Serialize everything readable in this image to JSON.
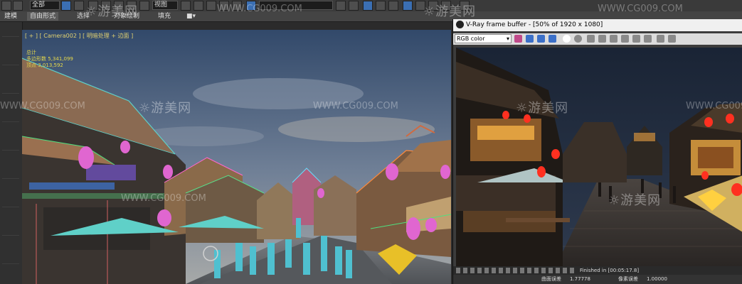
{
  "toolbar": {
    "selection_filter": "全部",
    "view_dropdown": "视图",
    "named_set_field": "",
    "icons": [
      "undo-icon",
      "redo-icon",
      "link-icon",
      "unlink-icon",
      "bind-icon",
      "select-icon",
      "select-region-icon",
      "move-icon",
      "rotate-icon",
      "scale-icon",
      "snap-icon",
      "angle-snap-icon",
      "mirror-icon",
      "align-icon",
      "layer-icon",
      "curve-editor-icon",
      "schematic-icon",
      "material-editor-icon",
      "render-setup-icon",
      "render-frame-icon",
      "render-icon",
      "chat-icon"
    ]
  },
  "ribbon": {
    "tabs": [
      {
        "label": "建模"
      },
      {
        "label": "自由形式"
      },
      {
        "label": "选择"
      },
      {
        "label": "对象绘制"
      },
      {
        "label": "填充"
      }
    ]
  },
  "viewport": {
    "label": "[ + ] [ Camera002 ] [ 明暗处理 + 边面 ]",
    "stats_title": "总计",
    "polys_label": "多边形数",
    "polys_value": "5,341,099",
    "verts_label": "顶点",
    "verts_value": "3,013,592"
  },
  "vfb": {
    "title": "V-Ray frame buffer - [50% of 1920 x 1080]",
    "channel": "RGB color",
    "status": "Finished in [00:05:17.8]"
  },
  "bottom": {
    "left_label": "曲面误差",
    "left_value": "1.77778",
    "right_label": "像素误差",
    "right_value": "1.00000"
  },
  "watermark": {
    "brand": "游美网",
    "url": "WWW.CG009.COM"
  },
  "colors": {
    "sky_top": "#32496a",
    "sky_bottom": "#a7a9a8",
    "render_warm": "#e0a040",
    "ui_dark": "#2b2b2b"
  }
}
